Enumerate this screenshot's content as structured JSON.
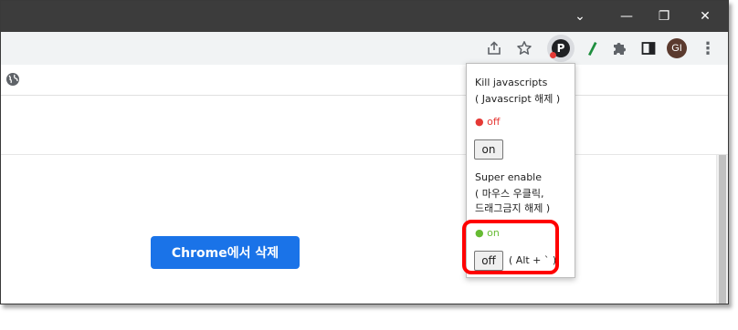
{
  "window": {
    "chevron_glyph": "⌄",
    "minimize_glyph": "—",
    "restore_glyph": "❐",
    "close_glyph": "✕"
  },
  "toolbar": {
    "avatar_initials": "GI",
    "menu_glyph": "⋮",
    "extension_badge_letter": "P"
  },
  "page": {
    "remove_button_label": "Chrome에서 삭제"
  },
  "popup": {
    "kill_title": "Kill javascripts",
    "kill_subtitle": "( Javascript 해제 )",
    "kill_status": "● off",
    "kill_button_label": "on",
    "super_title": "Super enable",
    "super_subtitle_line1": "( 마우스 우클릭,",
    "super_subtitle_line2": "드래그금지 해제 )",
    "super_status": "● on",
    "super_button_label": "off",
    "shortcut_text": "( Alt + ` )"
  },
  "colors": {
    "titlebar": "#3c3c3c",
    "toolbar": "#f1f3f4",
    "primary_button": "#1a73e8",
    "status_off": "#e53935",
    "status_on": "#66bb33",
    "highlight": "#ff0000"
  }
}
